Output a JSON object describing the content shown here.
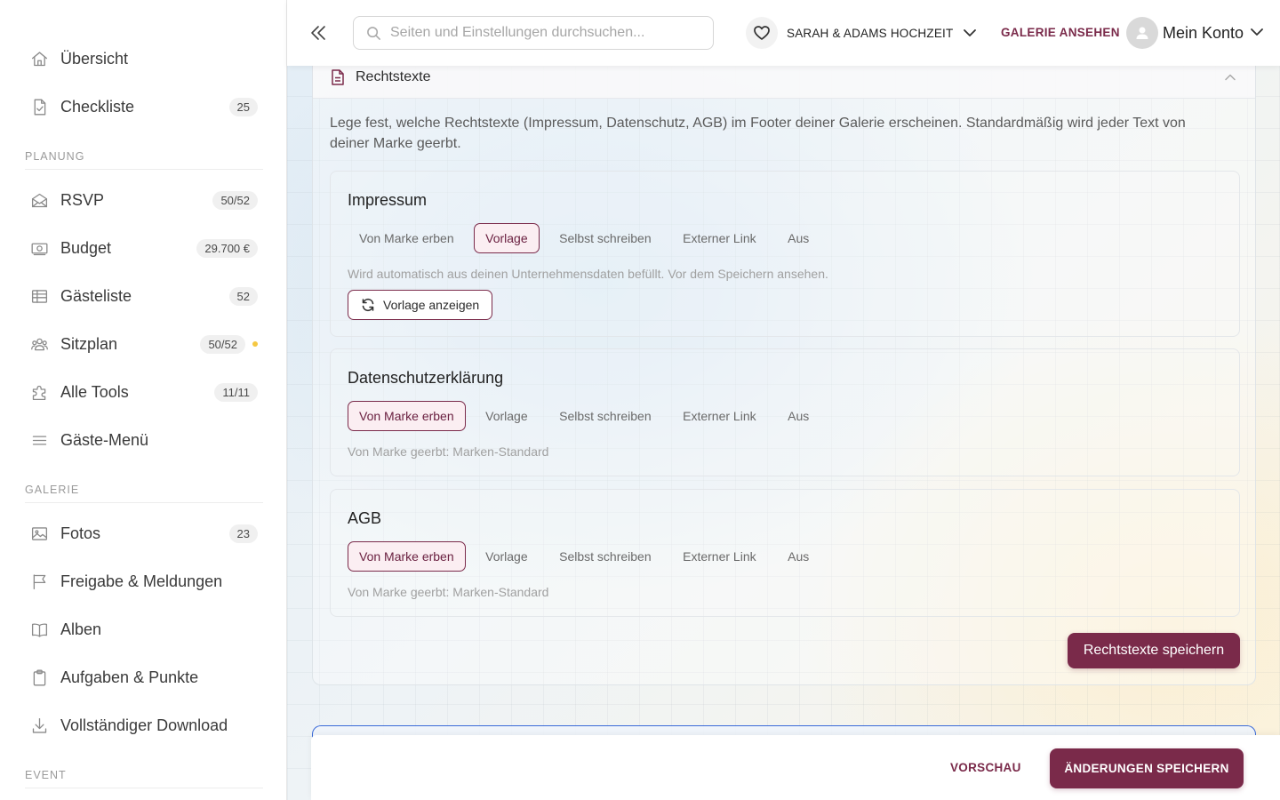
{
  "sidebar": {
    "items": [
      {
        "label": "Übersicht",
        "icon": "home-icon",
        "badge": ""
      },
      {
        "label": "Checkliste",
        "icon": "checklist-icon",
        "badge": "25"
      },
      {
        "label": "RSVP",
        "icon": "envelope-icon",
        "badge": "50/52"
      },
      {
        "label": "Budget",
        "icon": "money-icon",
        "badge": "29.700 €"
      },
      {
        "label": "Gästeliste",
        "icon": "table-icon",
        "badge": "52"
      },
      {
        "label": "Sitzplan",
        "icon": "people-icon",
        "badge": "50/52"
      },
      {
        "label": "Alle Tools",
        "icon": "puzzle-icon",
        "badge": "11/11"
      },
      {
        "label": "Gäste-Menü",
        "icon": "menu-icon",
        "badge": ""
      },
      {
        "label": "Fotos",
        "icon": "image-icon",
        "badge": "23"
      },
      {
        "label": "Freigabe & Meldungen",
        "icon": "flag-icon",
        "badge": ""
      },
      {
        "label": "Alben",
        "icon": "book-icon",
        "badge": ""
      },
      {
        "label": "Aufgaben & Punkte",
        "icon": "clipboard-icon",
        "badge": ""
      },
      {
        "label": "Vollständiger Download",
        "icon": "download-icon",
        "badge": ""
      }
    ],
    "sections": {
      "planung": "PLANUNG",
      "galerie": "GALERIE",
      "event": "EVENT"
    },
    "status_dot_color": "#f5c842"
  },
  "topbar": {
    "search_placeholder": "Seiten und Einstellungen durchsuchen...",
    "event_name": "SARAH & ADAMS HOCHZEIT",
    "gallery_link": "GALERIE ANSEHEN",
    "account_label": "Mein Konto"
  },
  "card": {
    "title": "Rechtstexte",
    "description": "Lege fest, welche Rechtstexte (Impressum, Datenschutz, AGB) im Footer deiner Galerie erscheinen. Standardmäßig wird jeder Text von deiner Marke geerbt.",
    "options": [
      "Von Marke erben",
      "Vorlage",
      "Selbst schreiben",
      "Externer Link",
      "Aus"
    ],
    "sections": [
      {
        "heading": "Impressum",
        "selected": "Vorlage",
        "hint": "Wird automatisch aus deinen Unternehmensdaten befüllt. Vor dem Speichern ansehen.",
        "button": "Vorlage anzeigen"
      },
      {
        "heading": "Datenschutzerklärung",
        "selected": "Von Marke erben",
        "hint": "Von Marke geerbt: Marken-Standard"
      },
      {
        "heading": "AGB",
        "selected": "Von Marke erben",
        "hint": "Von Marke geerbt: Marken-Standard"
      }
    ],
    "save_label": "Rechtstexte speichern"
  },
  "bottombar": {
    "preview_label": "VORSCHAU",
    "save_label": "ÄNDERUNGEN SPEICHERN"
  },
  "colors": {
    "accent": "#7a2a4a",
    "accent_bg": "#fbeef2",
    "focus_blue": "#3a6ad8"
  }
}
